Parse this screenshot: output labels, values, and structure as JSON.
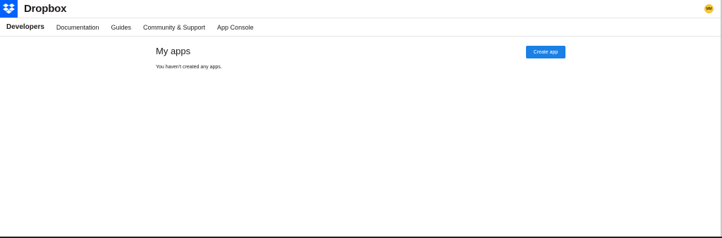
{
  "header": {
    "brand": "Dropbox",
    "logo_icon": "dropbox-logo-icon",
    "brand_color": "#0061fe",
    "avatar_initials": "MM",
    "avatar_color": "#f6c53d"
  },
  "nav": {
    "primary": "Developers",
    "items": [
      {
        "label": "Documentation"
      },
      {
        "label": "Guides"
      },
      {
        "label": "Community & Support"
      },
      {
        "label": "App Console"
      }
    ]
  },
  "main": {
    "title": "My apps",
    "empty_message": "You haven't created any apps.",
    "create_button": "Create app",
    "button_color": "#1a80e5"
  }
}
